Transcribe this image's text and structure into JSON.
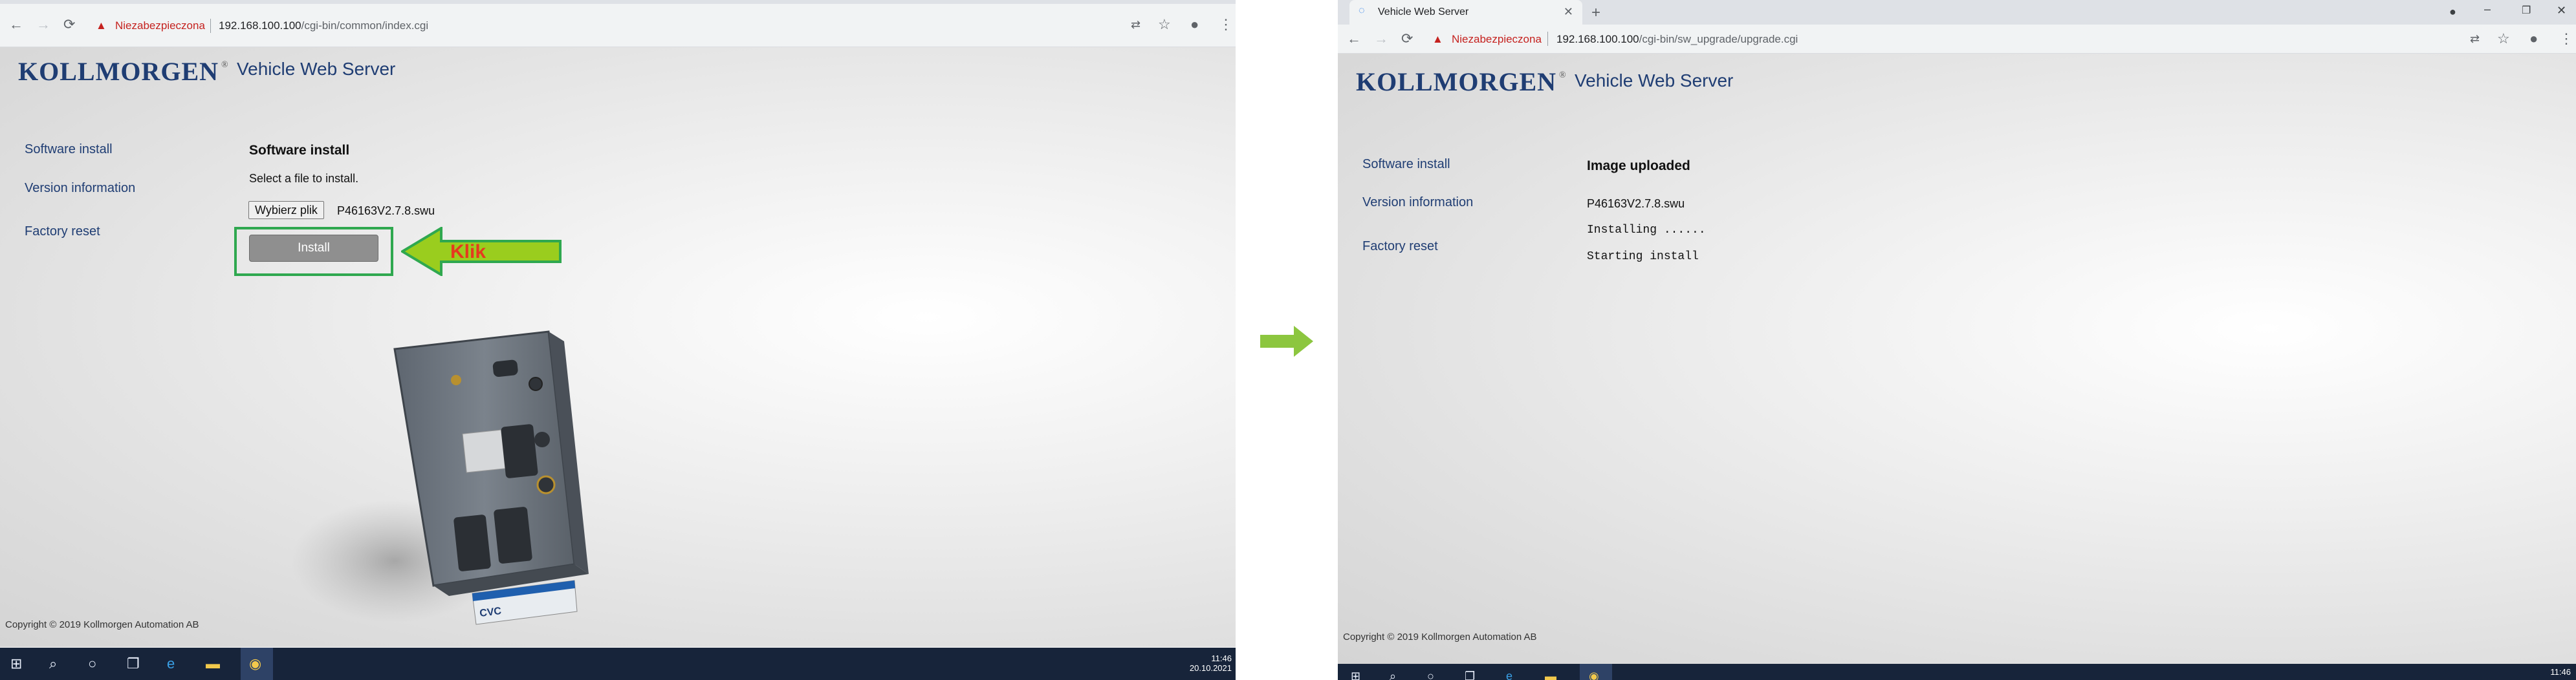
{
  "left": {
    "browser": {
      "security_warning": "Niezabezpieczona",
      "url_host": "192.168.100.100",
      "url_path": "/cgi-bin/common/index.cgi"
    },
    "header": {
      "brand": "KOLLMORGEN",
      "brand_mark": "®",
      "app_title": "Vehicle Web Server"
    },
    "sidebar": {
      "items": [
        {
          "label": "Software install"
        },
        {
          "label": "Version information"
        },
        {
          "label": "Factory reset"
        }
      ]
    },
    "main": {
      "section_title": "Software install",
      "instruction": "Select a file to install.",
      "file_button_label": "Wybierz plik",
      "selected_file": "P46163V2.7.8.swu",
      "install_button_label": "Install"
    },
    "annotation": {
      "arrow_label": "Klik",
      "arrow_color": "#9acd1e",
      "label_color": "#e53a1f",
      "box_color": "#2fa84f"
    },
    "device_label": "CVC",
    "footer": {
      "copyright": "Copyright © 2019 Kollmorgen Automation AB"
    },
    "taskbar": {
      "icons": [
        "windows-start-icon",
        "search-icon",
        "cortana-icon",
        "task-view-icon",
        "edge-icon",
        "file-explorer-icon",
        "chrome-icon"
      ],
      "time": "11:46",
      "date": "20.10.2021"
    }
  },
  "transition_arrow_color": "#8cc63f",
  "right": {
    "browser": {
      "tab_title": "Vehicle Web Server",
      "security_warning": "Niezabezpieczona",
      "url_host": "192.168.100.100",
      "url_path": "/cgi-bin/sw_upgrade/upgrade.cgi"
    },
    "header": {
      "brand": "KOLLMORGEN",
      "brand_mark": "®",
      "app_title": "Vehicle Web Server"
    },
    "sidebar": {
      "items": [
        {
          "label": "Software install"
        },
        {
          "label": "Version information"
        },
        {
          "label": "Factory reset"
        }
      ]
    },
    "main": {
      "status_title": "Image uploaded",
      "file_name": "P46163V2.7.8.swu",
      "installing": "Installing ......",
      "starting": "Starting install"
    },
    "footer": {
      "copyright": "Copyright © 2019 Kollmorgen Automation AB"
    },
    "taskbar": {
      "icons": [
        "windows-start-icon",
        "search-icon",
        "cortana-icon",
        "task-view-icon",
        "edge-icon",
        "file-explorer-icon",
        "chrome-icon"
      ],
      "time": "11:46"
    }
  }
}
